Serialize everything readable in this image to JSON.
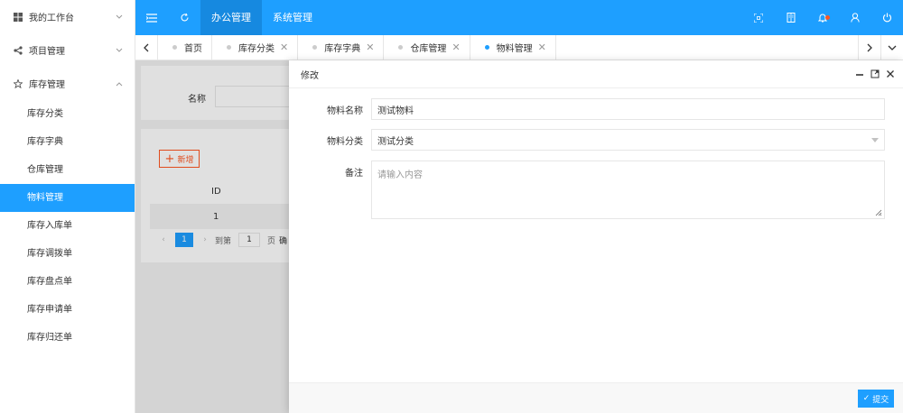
{
  "sidebar": {
    "groups": [
      {
        "label": "我的工作台",
        "icon": "windows-icon"
      },
      {
        "label": "项目管理",
        "icon": "share-icon"
      },
      {
        "label": "库存管理",
        "icon": "star-icon"
      }
    ],
    "items": [
      "库存分类",
      "库存字典",
      "仓库管理",
      "物料管理",
      "库存入库单",
      "库存调拨单",
      "库存盘点单",
      "库存申请单",
      "库存归还单"
    ],
    "active_item": "物料管理"
  },
  "topbar": {
    "menus": [
      "办公管理",
      "系统管理"
    ],
    "active_menu": "办公管理",
    "accent_color": "#1e9fff"
  },
  "tabs": {
    "items": [
      {
        "label": "首页",
        "closable": false
      },
      {
        "label": "库存分类",
        "closable": true
      },
      {
        "label": "库存字典",
        "closable": true
      },
      {
        "label": "仓库管理",
        "closable": true
      },
      {
        "label": "物料管理",
        "closable": true
      }
    ],
    "active": "物料管理"
  },
  "background": {
    "search_label": "名称",
    "add_button": "新增",
    "table_header_id": "ID",
    "table_row_id": "1",
    "pager": {
      "current_page": "1",
      "goto_label": "到第",
      "goto_value": "1",
      "page_unit": "页",
      "confirm": "确"
    }
  },
  "dialog": {
    "title": "修改",
    "fields": {
      "name_label": "物料名称",
      "name_value": "测试物料",
      "category_label": "物料分类",
      "category_value": "测试分类",
      "remark_label": "备注",
      "remark_placeholder": "请输入内容"
    },
    "submit_label": "提交"
  }
}
